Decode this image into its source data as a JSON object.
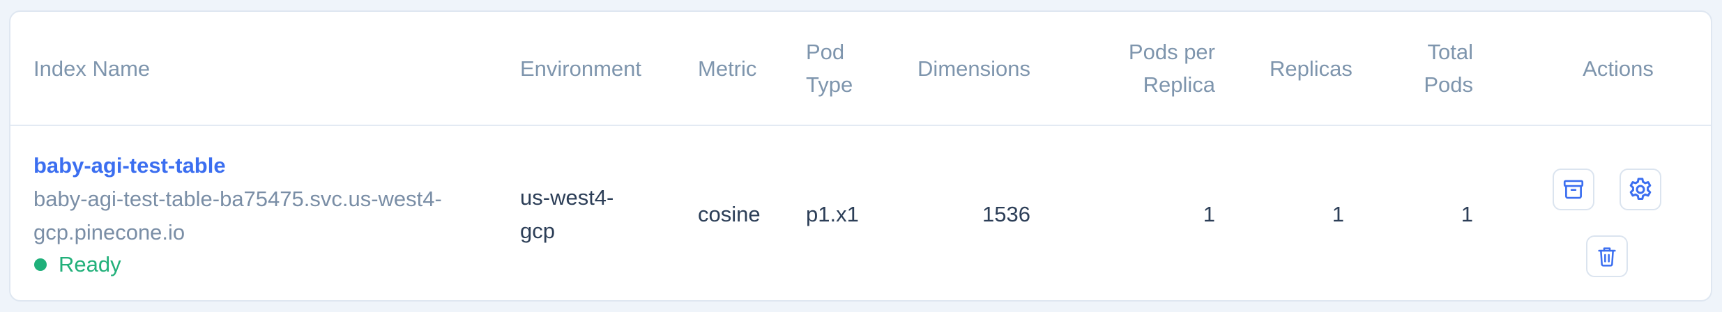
{
  "headers": {
    "index_name": "Index Name",
    "environment": "Environment",
    "metric": "Metric",
    "pod_type_line1": "Pod",
    "pod_type_line2": "Type",
    "dimensions": "Dimensions",
    "pods_per_replica_line1": "Pods per",
    "pods_per_replica_line2": "Replica",
    "replicas": "Replicas",
    "total_pods_line1": "Total",
    "total_pods_line2": "Pods",
    "actions": "Actions"
  },
  "rows": [
    {
      "index_name": "baby-agi-test-table",
      "host_line1": "baby-agi-test-table-ba75475.svc.us-west4-",
      "host_line2": "gcp.pinecone.io",
      "status": "Ready",
      "environment_line1": "us-west4-",
      "environment_line2": "gcp",
      "metric": "cosine",
      "pod_type": "p1.x1",
      "dimensions": "1536",
      "pods_per_replica": "1",
      "replicas": "1",
      "total_pods": "1"
    }
  ],
  "icons": {
    "archive": "archive-icon",
    "settings": "gear-icon",
    "delete": "trash-icon"
  },
  "colors": {
    "link": "#3b6ef0",
    "status_ready": "#1fb07a",
    "header_text": "#7e95ad",
    "body_text": "#2c3e57",
    "icon_blue": "#3b6ef0"
  }
}
